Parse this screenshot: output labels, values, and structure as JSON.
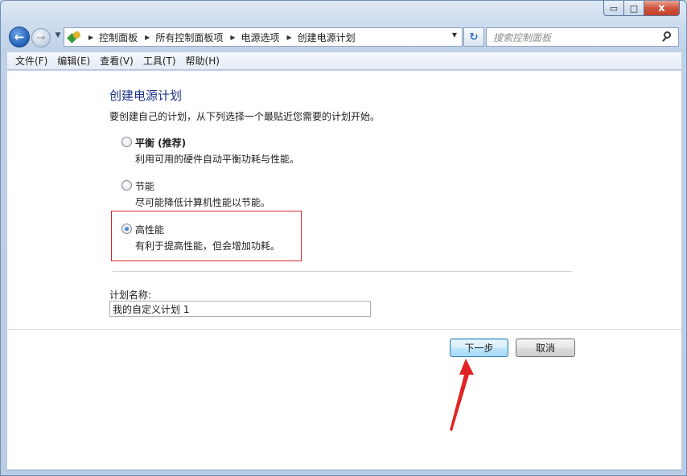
{
  "window": {
    "caption_buttons": {
      "minimize": "▭",
      "maximize": "□",
      "close": "x"
    }
  },
  "nav": {
    "back_glyph": "←",
    "forward_glyph": "→",
    "breadcrumb": [
      "控制面板",
      "所有控制面板项",
      "电源选项",
      "创建电源计划"
    ],
    "search_placeholder": "搜索控制面板",
    "refresh_glyph": "↻"
  },
  "menu": [
    "文件(F)",
    "编辑(E)",
    "查看(V)",
    "工具(T)",
    "帮助(H)"
  ],
  "page": {
    "title": "创建电源计划",
    "subtitle": "要创建自己的计划，从下列选择一个最贴近您需要的计划开始。",
    "options": [
      {
        "label": "平衡 (推荐)",
        "description": "利用可用的硬件自动平衡功耗与性能。",
        "checked": false
      },
      {
        "label": "节能",
        "description": "尽可能降低计算机性能以节能。",
        "checked": false
      },
      {
        "label": "高性能",
        "description": "有利于提高性能，但会增加功耗。",
        "checked": true
      }
    ],
    "plan_name_label": "计划名称:",
    "plan_name_value": "我的自定义计划 1",
    "next_button": "下一步",
    "cancel_button": "取消"
  },
  "colors": {
    "title": "#1e3287",
    "highlight_box": "#d8232a",
    "annotation_arrow": "#e02424"
  }
}
